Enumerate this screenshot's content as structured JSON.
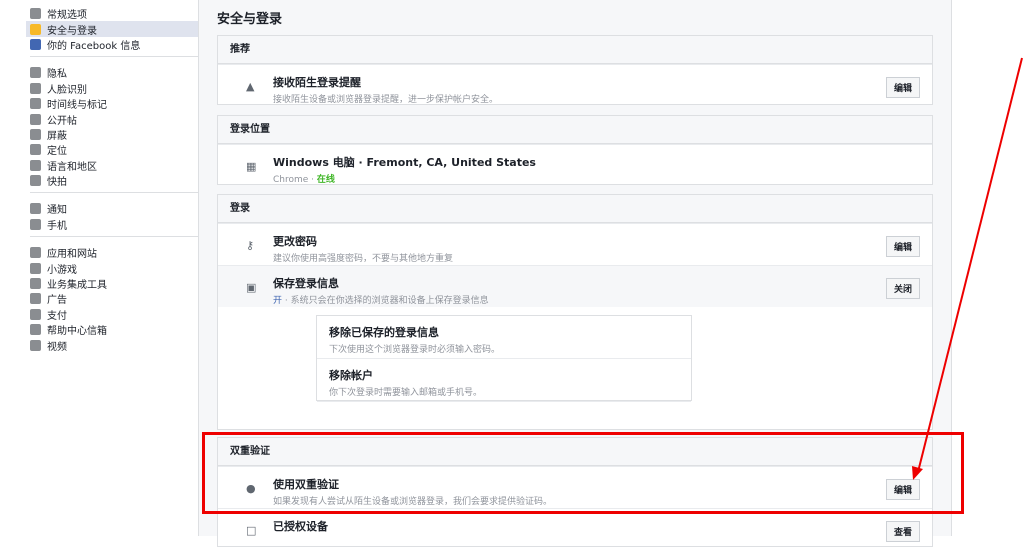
{
  "sidebar": {
    "g1": [
      "常规选项",
      "安全与登录",
      "你的 Facebook 信息"
    ],
    "g2": [
      "隐私",
      "人脸识别",
      "时间线与标记",
      "公开帖",
      "屏蔽",
      "定位",
      "语言和地区",
      "快拍"
    ],
    "g3": [
      "通知",
      "手机"
    ],
    "g4": [
      "应用和网站",
      "小游戏",
      "业务集成工具",
      "广告",
      "支付",
      "帮助中心信箱",
      "视频"
    ]
  },
  "title": "安全与登录",
  "s1": {
    "h": "推荐",
    "t": "接收陌生登录提醒",
    "s": "接收陌生设备或浏览器登录提醒，进一步保护帐户安全。",
    "b": "编辑"
  },
  "s2": {
    "h": "登录位置",
    "t": "Windows 电脑 · Fremont, CA, United States",
    "s": "Chrome · ",
    "on": "在线"
  },
  "s3": {
    "h": "登录",
    "r1t": "更改密码",
    "r1s": "建议你使用高强度密码，不要与其他地方重复",
    "b1": "编辑",
    "r2t": "保存登录信息",
    "r2on": "开",
    "r2s": " · 系统只会在你选择的浏览器和设备上保存登录信息",
    "b2": "关闭",
    "i1t": "移除已保存的登录信息",
    "i1s": "下次使用这个浏览器登录时必须输入密码。",
    "i2t": "移除帐户",
    "i2s": "你下次登录时需要输入邮箱或手机号。"
  },
  "s4": {
    "h": "双重验证",
    "t": "使用双重验证",
    "s": "如果发现有人尝试从陌生设备或浏览器登录，我们会要求提供验证码。",
    "b": "编辑",
    "r2t": "已授权设备",
    "b2": "查看"
  }
}
